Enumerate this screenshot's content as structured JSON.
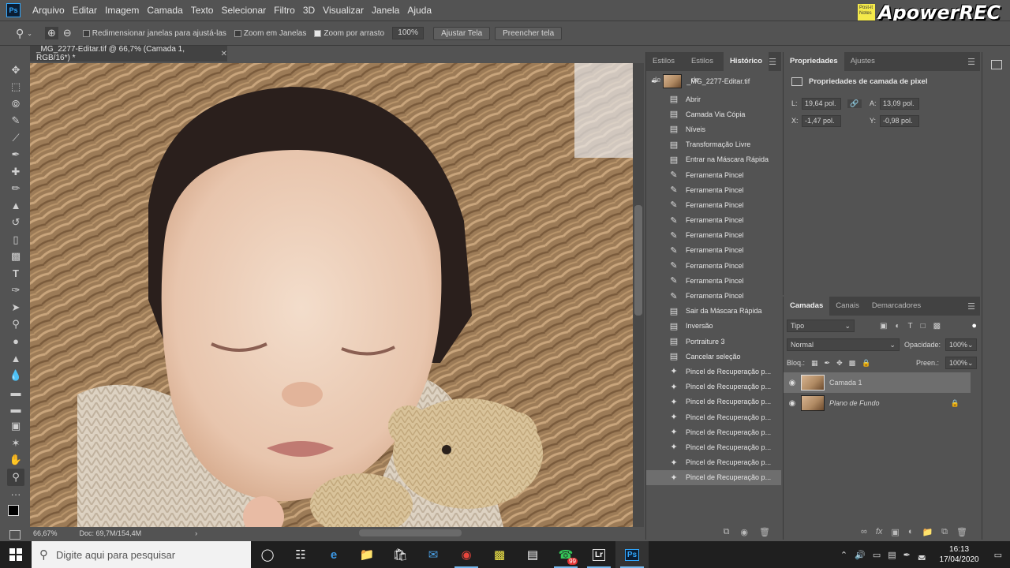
{
  "menubar": {
    "logo": "Ps",
    "items": [
      "Arquivo",
      "Editar",
      "Imagem",
      "Camada",
      "Texto",
      "Selecionar",
      "Filtro",
      "3D",
      "Visualizar",
      "Janela",
      "Ajuda"
    ],
    "watermark_postit": "Post-it Notes",
    "watermark": "ApowerREC"
  },
  "options": {
    "resize_windows": "Redimensionar janelas para ajustá-las",
    "zoom_all": "Zoom em Janelas",
    "scrubby_zoom": "Zoom por arrasto",
    "zoom_value": "100%",
    "fit_screen": "Ajustar Tela",
    "fill_screen": "Preencher tela"
  },
  "document": {
    "tab_title": "_MG_2277-Editar.tif @ 66,7% (Camada 1, RGB/16*) *",
    "zoom": "66,67%",
    "doc_info": "Doc: 69,7M/154,4M"
  },
  "history": {
    "tabs": [
      "Estilos de",
      "Estilos de",
      "Histórico"
    ],
    "snapshot": "_MG_2277-Editar.tif",
    "items": [
      {
        "label": "Abrir",
        "icon": "doc"
      },
      {
        "label": "Camada Via Cópia",
        "icon": "doc"
      },
      {
        "label": "Níveis",
        "icon": "doc"
      },
      {
        "label": "Transformação Livre",
        "icon": "doc"
      },
      {
        "label": "Entrar na Máscara Rápida",
        "icon": "doc"
      },
      {
        "label": "Ferramenta Pincel",
        "icon": "brush"
      },
      {
        "label": "Ferramenta Pincel",
        "icon": "brush"
      },
      {
        "label": "Ferramenta Pincel",
        "icon": "brush"
      },
      {
        "label": "Ferramenta Pincel",
        "icon": "brush"
      },
      {
        "label": "Ferramenta Pincel",
        "icon": "brush"
      },
      {
        "label": "Ferramenta Pincel",
        "icon": "brush"
      },
      {
        "label": "Ferramenta Pincel",
        "icon": "brush"
      },
      {
        "label": "Ferramenta Pincel",
        "icon": "brush"
      },
      {
        "label": "Ferramenta Pincel",
        "icon": "brush"
      },
      {
        "label": "Sair da Máscara Rápida",
        "icon": "doc"
      },
      {
        "label": "Inversão",
        "icon": "doc"
      },
      {
        "label": "Portraiture 3",
        "icon": "doc"
      },
      {
        "label": "Cancelar seleção",
        "icon": "doc"
      },
      {
        "label": "Pincel de Recuperação p...",
        "icon": "heal"
      },
      {
        "label": "Pincel de Recuperação p...",
        "icon": "heal"
      },
      {
        "label": "Pincel de Recuperação p...",
        "icon": "heal"
      },
      {
        "label": "Pincel de Recuperação p...",
        "icon": "heal"
      },
      {
        "label": "Pincel de Recuperação p...",
        "icon": "heal"
      },
      {
        "label": "Pincel de Recuperação p...",
        "icon": "heal"
      },
      {
        "label": "Pincel de Recuperação p...",
        "icon": "heal"
      },
      {
        "label": "Pincel de Recuperação p...",
        "icon": "heal"
      }
    ]
  },
  "properties": {
    "tabs": [
      "Propriedades",
      "Ajustes"
    ],
    "heading": "Propriedades de camada de pixel",
    "w_label": "L:",
    "w_value": "19,64 pol.",
    "h_label": "A:",
    "h_value": "13,09 pol.",
    "x_label": "X:",
    "x_value": "-1,47 pol.",
    "y_label": "Y:",
    "y_value": "-0,98 pol."
  },
  "layers": {
    "tabs": [
      "Camadas",
      "Canais",
      "Demarcadores"
    ],
    "filter": "Tipo",
    "blend_mode": "Normal",
    "opacity_label": "Opacidade:",
    "opacity": "100%",
    "lock_label": "Bloq.:",
    "fill_label": "Preen.:",
    "fill": "100%",
    "items": [
      {
        "name": "Camada 1"
      },
      {
        "name": "Plano de Fundo"
      }
    ]
  },
  "taskbar": {
    "search_placeholder": "Digite aqui para pesquisar",
    "badge": "99",
    "app_lr": "Lr",
    "app_ps": "Ps",
    "time": "16:13",
    "date": "17/04/2020"
  },
  "colors": {
    "panel": "#535353",
    "panel_dark": "#424242",
    "selected_row": "#6e6e6e",
    "ps_blue": "#31a8ff",
    "taskbar": "#1f1f1f"
  }
}
